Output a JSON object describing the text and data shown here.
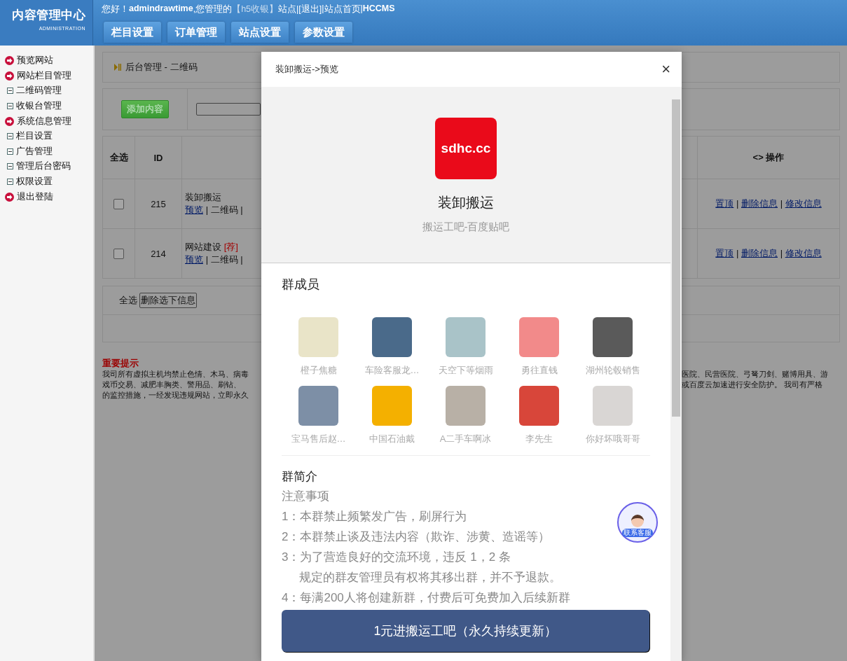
{
  "header": {
    "logo_title": "内容管理中心",
    "logo_subtitle": "ADMINISTRATION",
    "greeting": [
      {
        "kind": "text",
        "text": "您好！"
      },
      {
        "kind": "strong",
        "text": "admindrawtime"
      },
      {
        "kind": "text",
        "text": ",您管理的"
      },
      {
        "kind": "site",
        "text": "【h5收银】"
      },
      {
        "kind": "text",
        "text": "站点|"
      },
      {
        "kind": "link",
        "text": "[退出]"
      },
      {
        "kind": "text",
        "text": "|"
      },
      {
        "kind": "link",
        "text": "站点首页"
      },
      {
        "kind": "text",
        "text": "|"
      },
      {
        "kind": "strong",
        "text": "HCCMS"
      }
    ],
    "tabs": [
      "栏目设置",
      "订单管理",
      "站点设置",
      "参数设置"
    ]
  },
  "sidebar": {
    "items": [
      {
        "kind": "section",
        "label": "预览网站"
      },
      {
        "kind": "section",
        "label": "网站栏目管理"
      },
      {
        "kind": "item",
        "label": "二维码管理"
      },
      {
        "kind": "item",
        "label": "收银台管理"
      },
      {
        "kind": "section",
        "label": "系统信息管理"
      },
      {
        "kind": "item",
        "label": "栏目设置"
      },
      {
        "kind": "item",
        "label": "广告管理"
      },
      {
        "kind": "item",
        "label": "管理后台密码"
      },
      {
        "kind": "item",
        "label": "权限设置"
      },
      {
        "kind": "section",
        "label": "退出登陆"
      }
    ]
  },
  "breadcrumb": "后台管理 - 二维码",
  "toolbar": {
    "add_button": "添加内容"
  },
  "table": {
    "columns": {
      "select": "全选",
      "id": "ID",
      "actions": "<> 操作"
    },
    "rows": [
      {
        "checked": false,
        "id": "215",
        "title": "装卸搬运",
        "links": [
          "预览",
          "| 二维码 |"
        ],
        "actions": [
          {
            "kind": "link",
            "text": "置顶"
          },
          {
            "kind": "separator",
            "text": "|"
          },
          {
            "kind": "link",
            "text": "删除信息"
          },
          {
            "kind": "separator",
            "text": "|"
          },
          {
            "kind": "link",
            "text": "修改信息"
          }
        ]
      },
      {
        "checked": false,
        "id": "214",
        "title": "网站建设",
        "tag": "[荐]",
        "links": [
          "预览",
          "| 二维码 |"
        ],
        "actions": [
          {
            "kind": "link",
            "text": "置顶"
          },
          {
            "kind": "separator",
            "text": "|"
          },
          {
            "kind": "link",
            "text": "删除信息"
          },
          {
            "kind": "separator",
            "text": "|"
          },
          {
            "kind": "link",
            "text": "修改信息"
          }
        ]
      }
    ],
    "footer": {
      "select_all": "全选",
      "delete_button": "删除选下信息"
    }
  },
  "notice": {
    "title": "重要提示",
    "left_lines": [
      "我司所有虚拟主机均禁止色情、木马、病毒",
      "戏币交易、减肥丰胸类、警用品、刷钻、",
      "的监控措施，一经发现违规网站，立即永久"
    ],
    "right_lines": [
      "医院、民营医院、弓弩刀剑、赌博用具、游",
      "或百度云加速进行安全防护。 我司有严格"
    ]
  },
  "modal": {
    "title": "装卸搬运->预览",
    "close": "×",
    "logo_text": "sdhc.cc",
    "group_name": "装卸搬运",
    "group_source": "搬运工吧-百度贴吧",
    "members_heading": "群成员",
    "members": [
      {
        "name": "橙子焦糖",
        "color": "#e9e4c8"
      },
      {
        "name": "车险客服龙…",
        "color": "#4a6a8a"
      },
      {
        "name": "天空下等烟雨",
        "color": "#a9c3c8"
      },
      {
        "name": "勇往直钱",
        "color": "#f28a8a"
      },
      {
        "name": "湖州轮毂销售",
        "color": "#5a5a5a"
      },
      {
        "name": "宝马售后赵…",
        "color": "#7d8fa6"
      },
      {
        "name": "中国石油戴",
        "color": "#f4b000"
      },
      {
        "name": "A二手车啊冰",
        "color": "#b8b0a6"
      },
      {
        "name": "李先生",
        "color": "#d8463a"
      },
      {
        "name": "你好坏哦哥哥",
        "color": "#d9d6d4"
      }
    ],
    "intro_heading": "群简介",
    "intro_lines": [
      {
        "kind": "line",
        "text": "注意事项"
      },
      {
        "kind": "line",
        "text": "1：本群禁止频繁发广告，刷屏行为"
      },
      {
        "kind": "line",
        "text": "2：本群禁止谈及违法内容（欺诈、涉黄、造谣等）"
      },
      {
        "kind": "line",
        "text": "3：为了营造良好的交流环境，违反 1，2 条"
      },
      {
        "kind": "indent",
        "text": "规定的群友管理员有权将其移出群，并不予退款。"
      },
      {
        "kind": "line",
        "text": "4：每满200人将创建新群，付费后可免费加入后续新群"
      }
    ],
    "join_button": "1元进搬运工吧（永久持续更新）",
    "service_label": "联系客服"
  }
}
